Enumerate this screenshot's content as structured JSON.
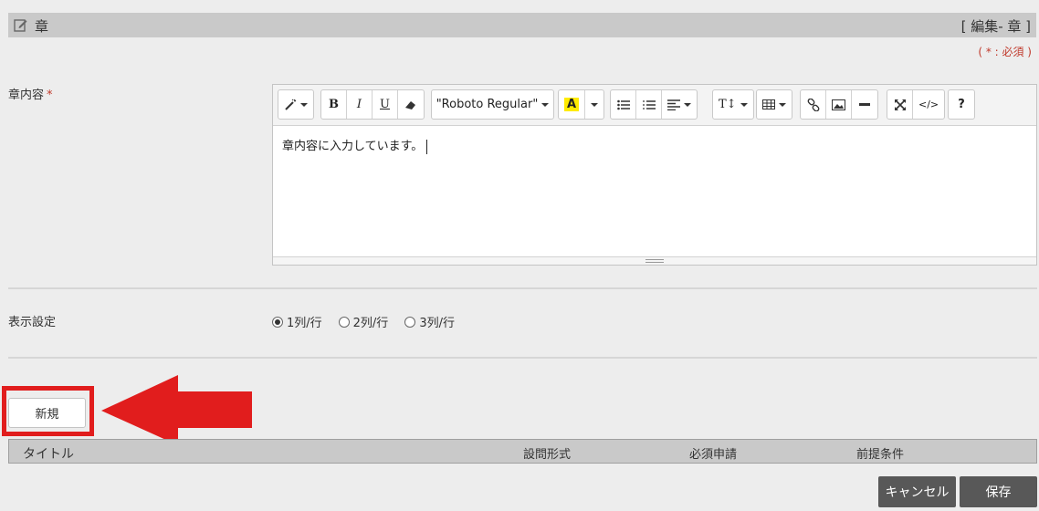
{
  "header": {
    "title": "章",
    "mode": "[ 編集- 章 ]"
  },
  "required_note": "( * : 必須 )",
  "content_field": {
    "label": "章内容",
    "required_mark": "*",
    "value": "章内容に入力しています。"
  },
  "toolbar": {
    "font_name": "\"Roboto Regular\"",
    "bold": "B",
    "italic": "I",
    "underline": "U",
    "font_color": "A",
    "font_size": "T↕",
    "help": "?"
  },
  "display_setting": {
    "label": "表示設定",
    "options": [
      "1列/行",
      "2列/行",
      "3列/行"
    ],
    "selected": "1列/行"
  },
  "new_button": "新規",
  "table": {
    "columns": [
      "タイトル",
      "設問形式",
      "必須申請",
      "前提条件"
    ]
  },
  "footer": {
    "cancel": "キャンセル",
    "save": "保存"
  },
  "colors": {
    "accent_red": "#e11d1d",
    "header_gray": "#c9c9c9",
    "button_dark": "#585858"
  }
}
